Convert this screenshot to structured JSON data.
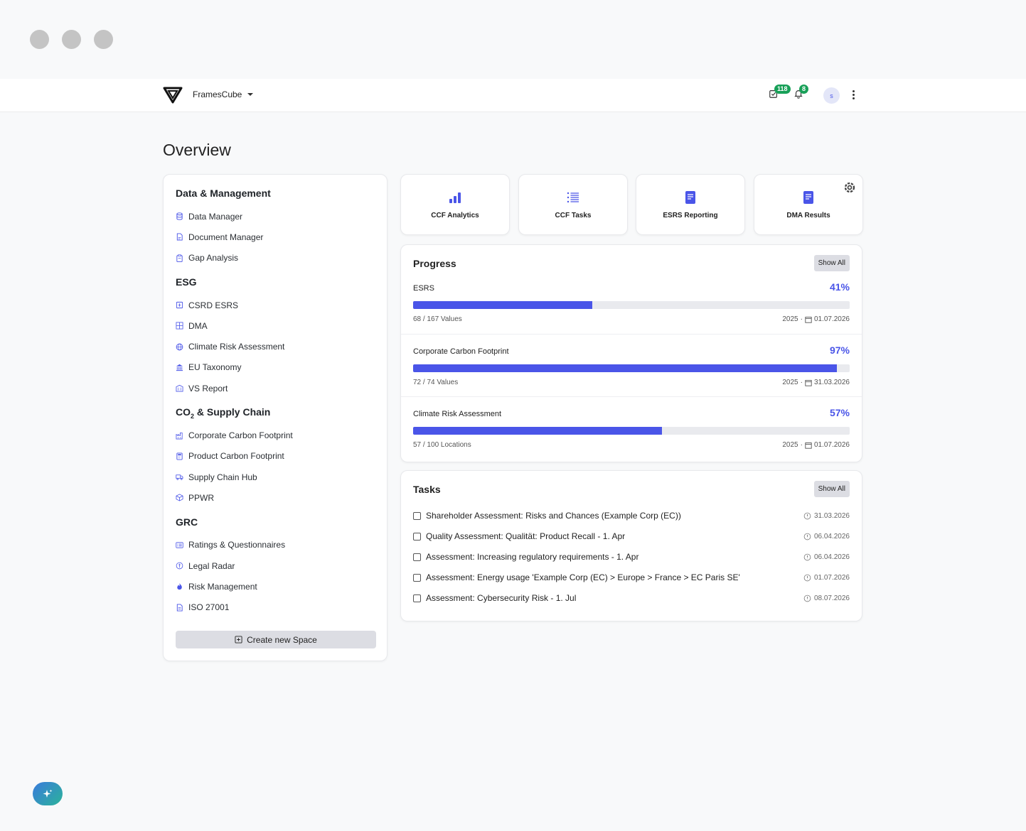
{
  "header": {
    "org_name": "FramesCube",
    "tasks_badge": "118",
    "notifications_badge": "8",
    "avatar_initial": "s"
  },
  "page": {
    "title": "Overview"
  },
  "sidebar": {
    "sections": [
      {
        "title": "Data & Management",
        "items": [
          {
            "label": "Data Manager",
            "icon": "database-icon"
          },
          {
            "label": "Document Manager",
            "icon": "document-icon"
          },
          {
            "label": "Gap Analysis",
            "icon": "clipboard-icon"
          }
        ]
      },
      {
        "title": "ESG",
        "items": [
          {
            "label": "CSRD ESRS",
            "icon": "csrd-icon"
          },
          {
            "label": "DMA",
            "icon": "grid-icon"
          },
          {
            "label": "Climate Risk Assessment",
            "icon": "globe-icon"
          },
          {
            "label": "EU Taxonomy",
            "icon": "bank-icon"
          },
          {
            "label": "VS Report",
            "icon": "building-icon"
          }
        ]
      },
      {
        "title_pre": "CO",
        "title_sub": "2",
        "title_post": " & Supply Chain",
        "items": [
          {
            "label": "Corporate Carbon Footprint",
            "icon": "factory-icon"
          },
          {
            "label": "Product Carbon Footprint",
            "icon": "calculator-icon"
          },
          {
            "label": "Supply Chain Hub",
            "icon": "truck-icon"
          },
          {
            "label": "PPWR",
            "icon": "package-icon"
          }
        ]
      },
      {
        "title": "GRC",
        "items": [
          {
            "label": "Ratings & Questionnaires",
            "icon": "list-card-icon"
          },
          {
            "label": "Legal Radar",
            "icon": "legal-icon"
          },
          {
            "label": "Risk Management",
            "icon": "flame-icon"
          },
          {
            "label": "ISO 27001",
            "icon": "file-icon"
          }
        ]
      }
    ],
    "create_button": "Create new Space"
  },
  "tiles": [
    {
      "label": "CCF Analytics",
      "icon": "bar-chart-icon"
    },
    {
      "label": "CCF Tasks",
      "icon": "list-icon"
    },
    {
      "label": "ESRS Reporting",
      "icon": "report-icon"
    },
    {
      "label": "DMA Results",
      "icon": "report-icon"
    }
  ],
  "progress": {
    "title": "Progress",
    "show_all": "Show All",
    "rows": [
      {
        "name": "ESRS",
        "percent_label": "41%",
        "fraction": 0.41,
        "count": "68 / 167 Values",
        "year": "2025",
        "due": "01.07.2026"
      },
      {
        "name": "Corporate Carbon Footprint",
        "percent_label": "97%",
        "fraction": 0.97,
        "count": "72 / 74 Values",
        "year": "2025",
        "due": "31.03.2026"
      },
      {
        "name": "Climate Risk Assessment",
        "percent_label": "57%",
        "fraction": 0.57,
        "count": "57 / 100 Locations",
        "year": "2025",
        "due": "01.07.2026"
      }
    ]
  },
  "tasks": {
    "title": "Tasks",
    "show_all": "Show All",
    "items": [
      {
        "title": "Shareholder Assessment: Risks and Chances (Example Corp (EC))",
        "date": "31.03.2026"
      },
      {
        "title": "Quality Assessment: Qualität: Product Recall - 1. Apr",
        "date": "06.04.2026"
      },
      {
        "title": "Assessment: Increasing regulatory requirements - 1. Apr",
        "date": "06.04.2026"
      },
      {
        "title": "Assessment: Energy usage 'Example Corp (EC) > Europe > France > EC Paris SE'",
        "date": "01.07.2026"
      },
      {
        "title": "Assessment: Cybersecurity Risk - 1. Jul",
        "date": "08.07.2026"
      }
    ]
  },
  "colors": {
    "accent": "#4a55e8",
    "badge": "#18a058"
  }
}
